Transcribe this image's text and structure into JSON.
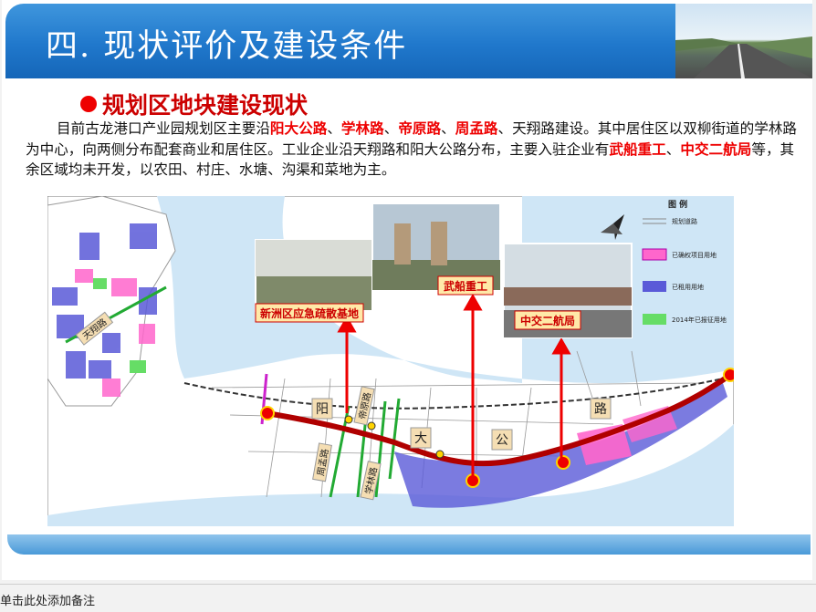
{
  "slide": {
    "header_title": "四. 现状评价及建设条件",
    "section_title": "规划区地块建设现状",
    "paragraph": [
      {
        "text": "目前古龙港口产业园规划区主要沿",
        "hl": false
      },
      {
        "text": "阳大公路",
        "hl": true
      },
      {
        "text": "、",
        "hl": false
      },
      {
        "text": "学林路",
        "hl": true
      },
      {
        "text": "、",
        "hl": false
      },
      {
        "text": "帝原路",
        "hl": true
      },
      {
        "text": "、",
        "hl": false
      },
      {
        "text": "周孟路",
        "hl": true
      },
      {
        "text": "、天翔路建设。其中居住区以双柳街道的学林路为中心，向两侧分布配套商业和居住区。工业企业沿天翔路和阳大公路分布，主要入驻企业有",
        "hl": false
      },
      {
        "text": "武船重工",
        "hl": true
      },
      {
        "text": "、",
        "hl": false
      },
      {
        "text": "中交二航局",
        "hl": true
      },
      {
        "text": "等，其余区域均未开发，以农田、村庄、水塘、沟渠和菜地为主。",
        "hl": false
      }
    ]
  },
  "map": {
    "photo_labels": {
      "emergency": "新洲区应急疏散基地",
      "wuchuan": "武船重工",
      "zhongjiao": "中交二航局"
    },
    "road_chars": [
      "阳",
      "大",
      "公",
      "路"
    ],
    "road_labels": {
      "tianxiang": "天翔路",
      "diyuan": "帝原路",
      "xuelin": "学林路",
      "zhoumeng": "周孟路"
    },
    "legend": {
      "title": "图  例",
      "items": [
        "规划道路",
        "已确权项目用地",
        "已租用用地",
        "2014年已报征用地"
      ]
    }
  },
  "notes_label": "单击此处添加备注",
  "colors": {
    "header": "#2078cc",
    "highlight": "#e00000",
    "road": "#b00000"
  }
}
